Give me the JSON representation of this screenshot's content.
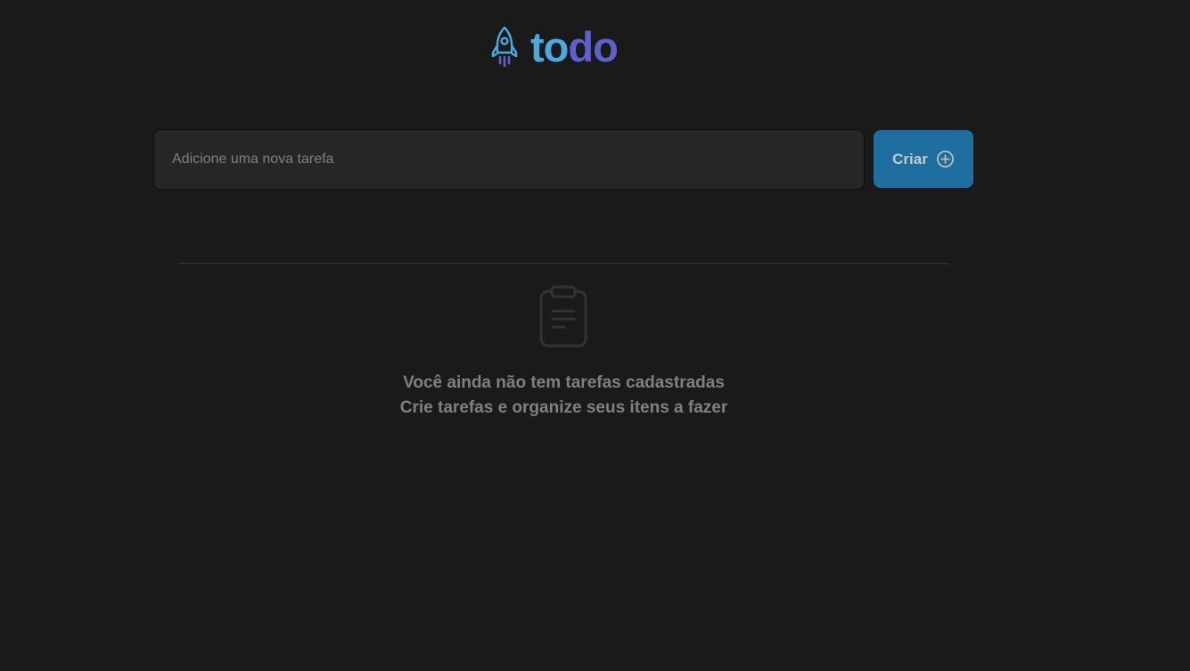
{
  "header": {
    "logo_icon": "rocket-icon",
    "logo_part_1": "to",
    "logo_part_2": "do"
  },
  "new_task": {
    "value": "",
    "placeholder": "Adicione uma nova tarefa",
    "button_label": "Criar",
    "button_icon": "plus-circle-icon"
  },
  "empty_state": {
    "icon": "clipboard-icon",
    "title": "Você ainda não tem tarefas cadastradas",
    "subtitle": "Crie tarefas e organize seus itens a fazer"
  },
  "colors": {
    "background": "#1a1a1a",
    "input_background": "#262626",
    "button_background": "#1e6f9f",
    "logo_blue": "#4ea8de",
    "logo_purple": "#5e60ce",
    "muted_text": "#808080"
  }
}
